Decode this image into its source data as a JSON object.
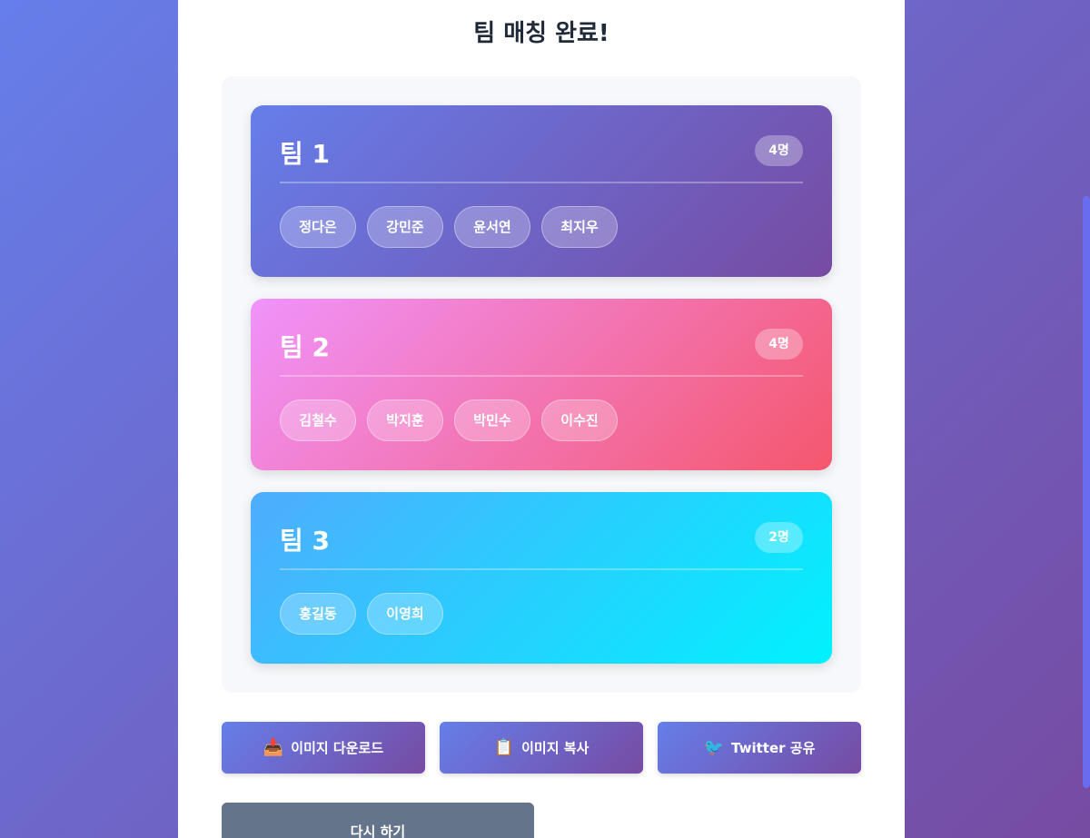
{
  "page": {
    "title": "팀 매칭 완료!"
  },
  "teams": [
    {
      "name": "팀 1",
      "count": "4명",
      "members": [
        "정다은",
        "강민준",
        "윤서연",
        "최지우"
      ]
    },
    {
      "name": "팀 2",
      "count": "4명",
      "members": [
        "김철수",
        "박지훈",
        "박민수",
        "이수진"
      ]
    },
    {
      "name": "팀 3",
      "count": "2명",
      "members": [
        "홍길동",
        "이영희"
      ]
    }
  ],
  "actions": {
    "download": {
      "icon": "📥",
      "label": "이미지 다운로드"
    },
    "copy": {
      "icon": "📋",
      "label": "이미지 복사"
    },
    "twitter": {
      "icon": "🐦",
      "label": "Twitter 공유"
    },
    "retry": {
      "label": "다시 하기"
    }
  },
  "colors": {
    "team1": [
      "#667eea",
      "#764ba2"
    ],
    "team2": [
      "#f093fb",
      "#f5576c"
    ],
    "team3": [
      "#4facfe",
      "#00f2fe"
    ],
    "retry": "#64748b"
  }
}
